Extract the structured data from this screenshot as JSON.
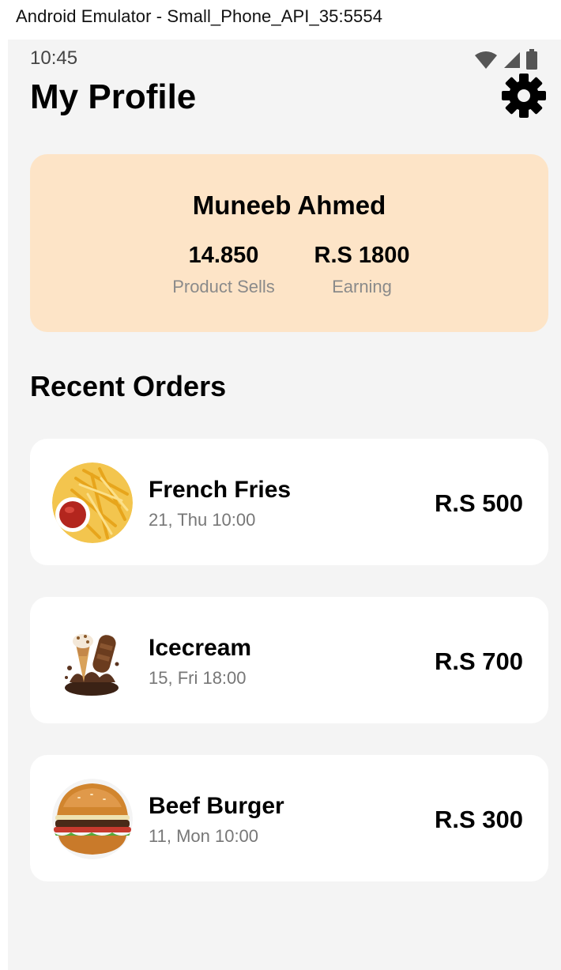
{
  "window": {
    "title": "Android Emulator - Small_Phone_API_35:5554"
  },
  "statusbar": {
    "time": "10:45",
    "icons": [
      "wifi-icon",
      "signal-icon",
      "battery-icon"
    ]
  },
  "header": {
    "title": "My Profile",
    "settings_icon": "gear-icon"
  },
  "profile": {
    "name": "Muneeb Ahmed",
    "stats": [
      {
        "value": "14.850",
        "label": "Product Sells"
      },
      {
        "value": "R.S 1800",
        "label": "Earning"
      }
    ]
  },
  "recent_orders": {
    "title": "Recent Orders",
    "items": [
      {
        "name": "French Fries",
        "time": "21, Thu 10:00",
        "price": "R.S 500",
        "image": "french-fries-image"
      },
      {
        "name": "Icecream",
        "time": "15, Fri 18:00",
        "price": "R.S 700",
        "image": "icecream-image"
      },
      {
        "name": "Beef Burger",
        "time": "11, Mon 10:00",
        "price": "R.S 300",
        "image": "beef-burger-image"
      }
    ]
  },
  "colors": {
    "screen_bg": "#f4f4f4",
    "profile_card_bg": "#fde4c7",
    "card_bg": "#ffffff",
    "muted_text": "#8a8a8a"
  }
}
